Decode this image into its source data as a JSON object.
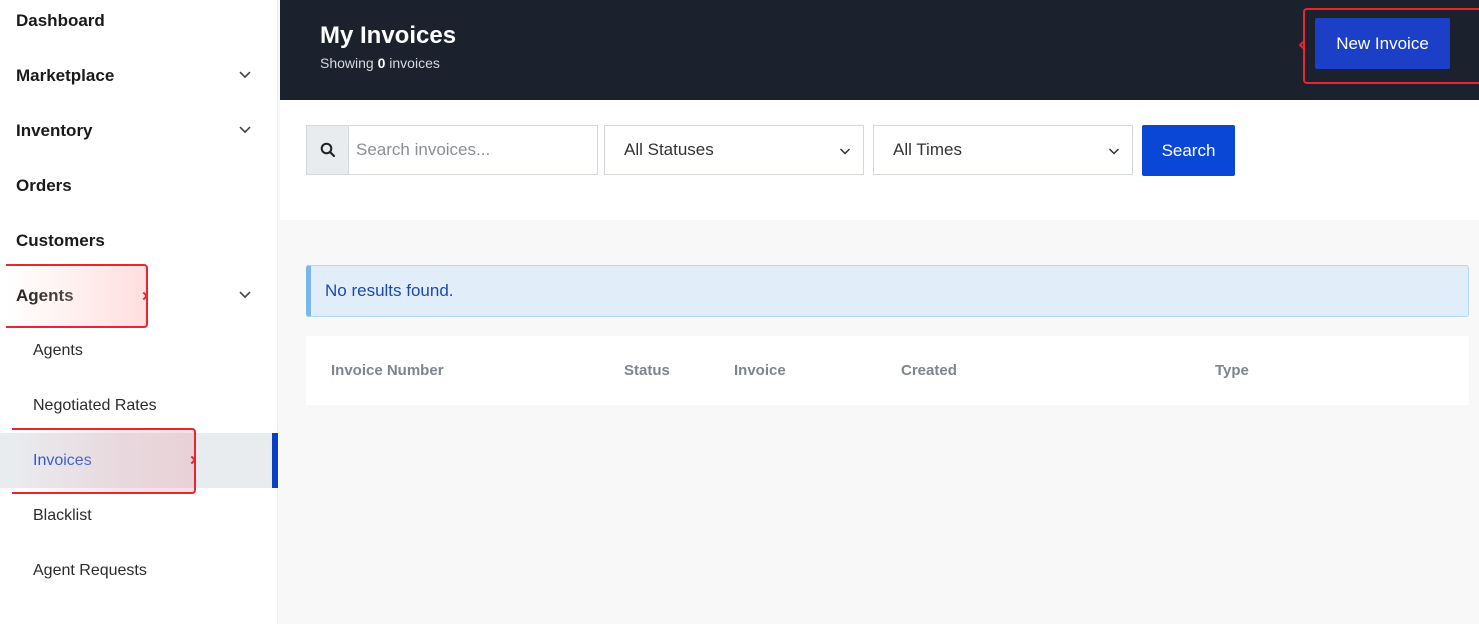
{
  "sidebar": {
    "items": [
      {
        "label": "Dashboard"
      },
      {
        "label": "Marketplace"
      },
      {
        "label": "Inventory"
      },
      {
        "label": "Orders"
      },
      {
        "label": "Customers"
      },
      {
        "label": "Agents"
      }
    ],
    "subitems": [
      {
        "label": "Agents"
      },
      {
        "label": "Negotiated Rates"
      },
      {
        "label": "Invoices",
        "active": true
      },
      {
        "label": "Blacklist"
      },
      {
        "label": "Agent Requests"
      }
    ]
  },
  "header": {
    "title": "My Invoices",
    "showing_prefix": "Showing",
    "count": "0",
    "showing_suffix": "invoices",
    "new_invoice_label": "New Invoice"
  },
  "filters": {
    "search_placeholder": "Search invoices...",
    "search_value": "",
    "status_selected": "All Statuses",
    "time_selected": "All Times",
    "search_button_label": "Search"
  },
  "alert": {
    "message": "No results found."
  },
  "table": {
    "columns": [
      "Invoice Number",
      "Status",
      "Invoice",
      "Created",
      "Type"
    ],
    "rows": []
  },
  "colors": {
    "header_bg": "#1b222d",
    "primary": "#0a47d6",
    "active_bar": "#0a3fc4",
    "highlight": "#e8262f"
  }
}
